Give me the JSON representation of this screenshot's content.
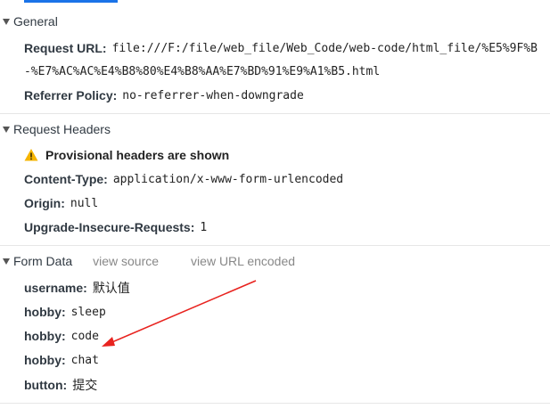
{
  "general": {
    "title": "General",
    "request_url_key": "Request URL:",
    "request_url_line1": "file:///F:/file/web_file/Web_Code/web-code/html_file/%E5%9F%B",
    "request_url_line2": "-%E7%AC%AC%E4%B8%80%E4%B8%AA%E7%BD%91%E9%A1%B5.html",
    "referrer_policy_key": "Referrer Policy:",
    "referrer_policy_value": "no-referrer-when-downgrade"
  },
  "request_headers": {
    "title": "Request Headers",
    "warning_icon": "warning-triangle-icon",
    "provisional_text": "Provisional headers are shown",
    "content_type_key": "Content-Type:",
    "content_type_value": "application/x-www-form-urlencoded",
    "origin_key": "Origin:",
    "origin_value": "null",
    "upgrade_key": "Upgrade-Insecure-Requests:",
    "upgrade_value": "1"
  },
  "form_data": {
    "title": "Form Data",
    "view_source_label": "view source",
    "view_url_encoded_label": "view URL encoded",
    "fields": [
      {
        "key": "username:",
        "value": "默认值"
      },
      {
        "key": "hobby:",
        "value": "sleep"
      },
      {
        "key": "hobby:",
        "value": "code"
      },
      {
        "key": "hobby:",
        "value": "chat"
      },
      {
        "key": "button:",
        "value": "提交"
      }
    ]
  },
  "colors": {
    "active_tab": "#1a73e8",
    "annotation_arrow": "#e8231f",
    "warning": "#f5b400"
  }
}
